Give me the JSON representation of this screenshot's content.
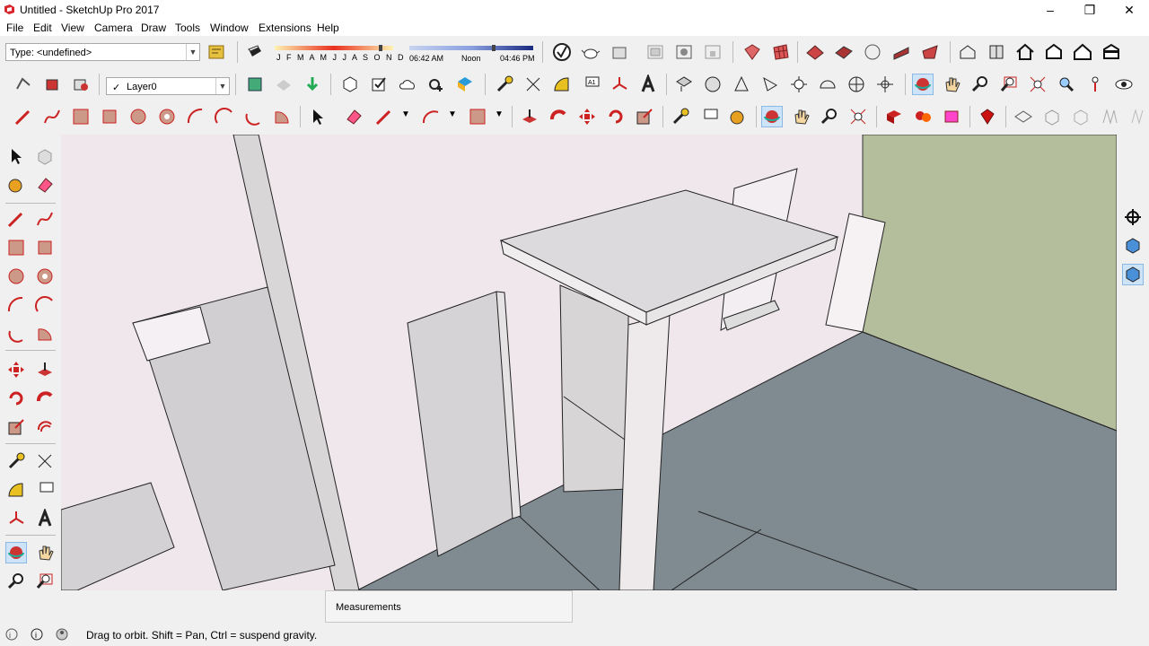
{
  "window": {
    "title": "Untitled - SketchUp Pro 2017"
  },
  "menu": [
    "File",
    "Edit",
    "View",
    "Camera",
    "Draw",
    "Tools",
    "Window",
    "Extensions",
    "Help"
  ],
  "toolbar": {
    "type_select": "Type: <undefined>",
    "layer_select": "Layer0",
    "months": "J F M A M J J A S O N D",
    "time_start": "06:42 AM",
    "time_noon": "Noon",
    "time_end": "04:46 PM"
  },
  "measurements": {
    "label": "Measurements"
  },
  "status": {
    "message": "Drag to orbit. Shift = Pan, Ctrl = suspend gravity."
  },
  "colors": {
    "ground": "#7f8a91",
    "wall_right": "#b4bd9c",
    "sky": "#efe7eb"
  },
  "icons": [
    "sketchup-logo-icon",
    "minimize-icon",
    "restore-icon",
    "close-icon",
    "select-icon",
    "eraser-icon",
    "pencil-icon",
    "orbit-icon",
    "pan-icon",
    "zoom-icon",
    "zoom-extents-icon"
  ]
}
